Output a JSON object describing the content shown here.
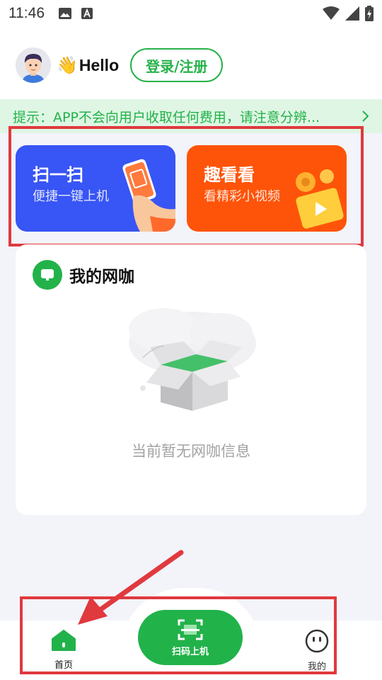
{
  "status_bar": {
    "time": "11:46"
  },
  "header": {
    "greeting_emoji": "👋",
    "greeting": "Hello",
    "login_label": "登录/注册"
  },
  "notice": {
    "text": "提示：APP不会向用户收取任何费用，请注意分辨..."
  },
  "cards": [
    {
      "title": "扫一扫",
      "subtitle": "便捷一键上机",
      "color": "#3855f5"
    },
    {
      "title": "趣看看",
      "subtitle": "看精彩小视频",
      "color": "#fe5409"
    }
  ],
  "netcafe": {
    "title": "我的网咖",
    "empty_text": "当前暂无网咖信息"
  },
  "bottom_nav": {
    "home_label": "首页",
    "scan_label": "扫码上机",
    "mine_label": "我的"
  },
  "colors": {
    "accent": "#22b24a",
    "annotation": "#e0393e"
  }
}
